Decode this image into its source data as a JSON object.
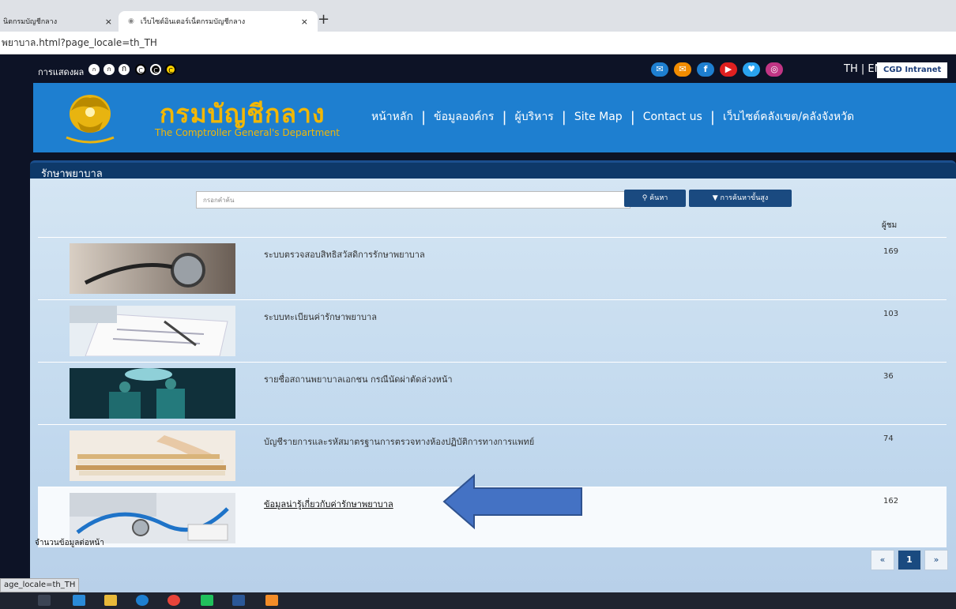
{
  "browser": {
    "tab1_title": "นิตกรมบัญชีกลาง",
    "tab2_title": "เว็บไซต์อินเตอร์เน็ตกรมบัญชีกลาง",
    "close_glyph": "×",
    "new_tab_glyph": "+",
    "address": "พยาบาล.html?page_locale=th_TH"
  },
  "topbar": {
    "display_label": "การแสดงผล",
    "font_sizes": [
      "ก",
      "ก",
      "ก",
      "C",
      "C",
      "C"
    ],
    "social_icons": [
      "mail-icon",
      "email-icon",
      "facebook-icon",
      "youtube-icon",
      "twitter-icon",
      "instagram-icon"
    ],
    "social_glyphs": [
      "✉",
      "✉",
      "f",
      "▶",
      "♥",
      "◎"
    ],
    "language": "TH | EN",
    "intranet_label": "CGD Intranet"
  },
  "header": {
    "brand_th": "กรมบัญชีกลาง",
    "brand_en": "The Comptroller General's Department",
    "nav": [
      "หน้าหลัก",
      "ข้อมูลองค์กร",
      "ผู้บริหาร",
      "Site Map",
      "Contact us",
      "เว็บไซต์คลังเขต/คลังจังหวัด"
    ],
    "separator": "|",
    "brand_color": "#f2b705"
  },
  "section": {
    "title": "รักษาพยาบาล"
  },
  "search": {
    "placeholder": "กรอกคำค้น",
    "search_label": "ค้นหา",
    "advanced_label": "การค้นหาขั้นสูง"
  },
  "list": {
    "column_header": "ผู้ชม",
    "rows": [
      {
        "title": "ระบบตรวจสอบสิทธิสวัสดิการรักษาพยาบาล",
        "views": "169",
        "image": "stethoscope"
      },
      {
        "title": "ระบบทะเบียนค่ารักษาพยาบาล",
        "views": "103",
        "image": "writing-form"
      },
      {
        "title": "รายชื่อสถานพยาบาลเอกชน กรณีนัดผ่าตัดล่วงหน้า",
        "views": "36",
        "image": "operating-room"
      },
      {
        "title": "บัญชีรายการและรหัสมาตรฐานการตรวจทางห้องปฏิบัติการทางการแพทย์",
        "views": "74",
        "image": "document-stack"
      },
      {
        "title": "ข้อมูลน่ารู้เกี่ยวกับค่ารักษาพยาบาล",
        "views": "162",
        "image": "stethoscope-keyboard"
      }
    ]
  },
  "footer": {
    "per_page_label": "จำนวนข้อมูลต่อหน้า",
    "prev": "«",
    "current_page": "1",
    "next": "»"
  },
  "status_bar": "age_locale=th_TH",
  "colors": {
    "accent": "#1e7fd0",
    "navy": "#1a4a80",
    "arrow": "#4472c4"
  }
}
